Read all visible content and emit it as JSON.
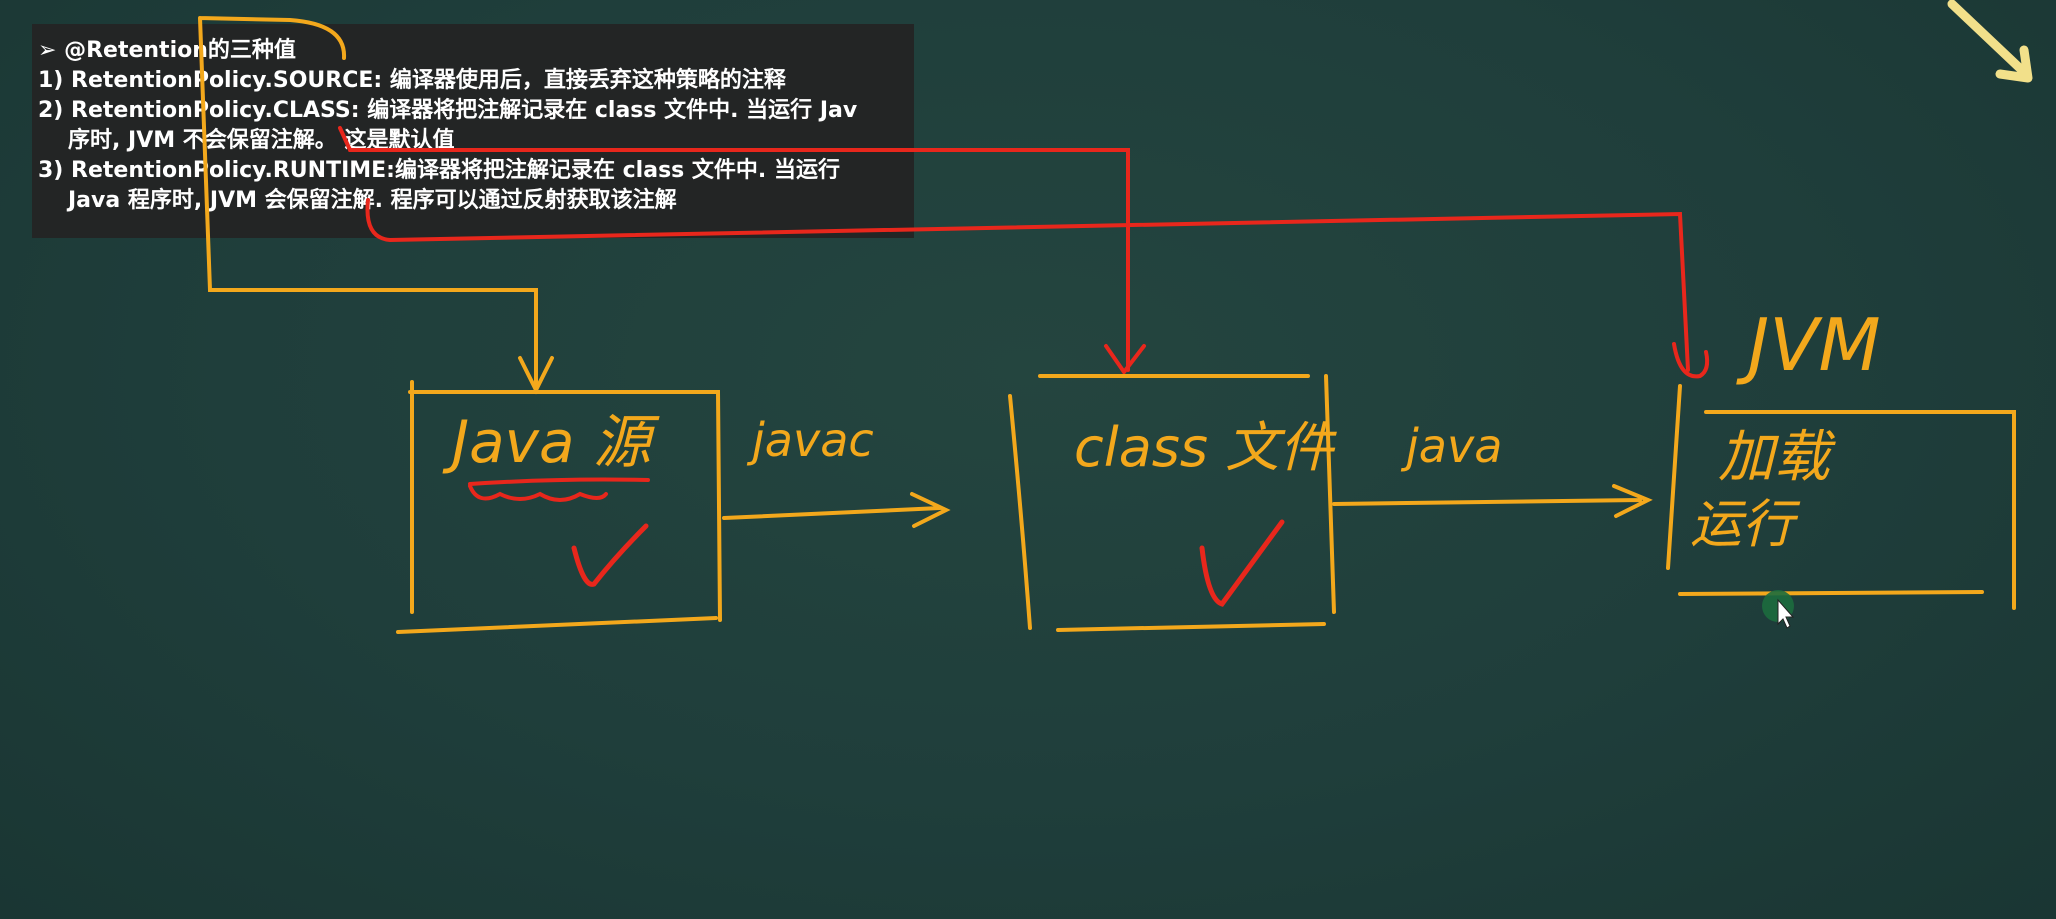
{
  "note": {
    "heading": "➢ @Retention的三种值",
    "item1": "1) RetentionPolicy.SOURCE: 编译器使用后，直接丢弃这种策略的注释",
    "item2a": "2) RetentionPolicy.CLASS: 编译器将把注解记录在 class 文件中. 当运行 Jav",
    "item2b": "序时, JVM 不会保留注解。 这是默认值",
    "item3a": "3) RetentionPolicy.RUNTIME:编译器将把注解记录在 class 文件中. 当运行",
    "item3b": "Java 程序时, JVM 会保留注解. 程序可以通过反射获取该注解"
  },
  "diagram": {
    "box1_label": "Java 源",
    "arrow1_label": "javac",
    "box2_label": "class 文件",
    "arrow2_label": "java",
    "box3_title": "JVM",
    "box3_line1": "加载",
    "box3_line2": "运行"
  },
  "colors": {
    "board": "#1f3e3b",
    "panel": "#242424",
    "marker_orange": "#f3a81c",
    "marker_red": "#e8271c",
    "pointer_yellow": "#f2e08a"
  },
  "icons": {
    "pointer": "arrow-pointer-icon",
    "check": "check-mark-icon",
    "cursor": "mouse-cursor-icon"
  }
}
